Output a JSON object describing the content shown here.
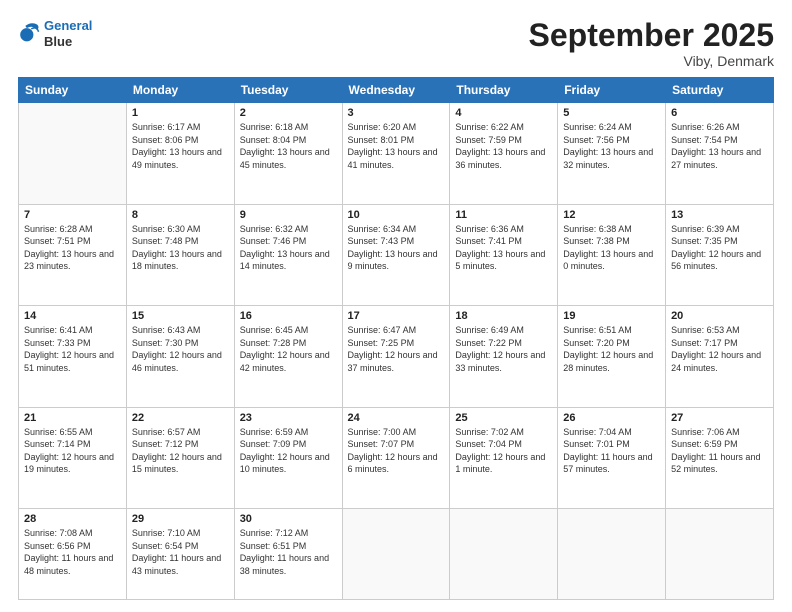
{
  "header": {
    "logo_line1": "General",
    "logo_line2": "Blue",
    "month": "September 2025",
    "location": "Viby, Denmark"
  },
  "weekdays": [
    "Sunday",
    "Monday",
    "Tuesday",
    "Wednesday",
    "Thursday",
    "Friday",
    "Saturday"
  ],
  "weeks": [
    [
      {
        "day": "",
        "sunrise": "",
        "sunset": "",
        "daylight": ""
      },
      {
        "day": "1",
        "sunrise": "Sunrise: 6:17 AM",
        "sunset": "Sunset: 8:06 PM",
        "daylight": "Daylight: 13 hours and 49 minutes."
      },
      {
        "day": "2",
        "sunrise": "Sunrise: 6:18 AM",
        "sunset": "Sunset: 8:04 PM",
        "daylight": "Daylight: 13 hours and 45 minutes."
      },
      {
        "day": "3",
        "sunrise": "Sunrise: 6:20 AM",
        "sunset": "Sunset: 8:01 PM",
        "daylight": "Daylight: 13 hours and 41 minutes."
      },
      {
        "day": "4",
        "sunrise": "Sunrise: 6:22 AM",
        "sunset": "Sunset: 7:59 PM",
        "daylight": "Daylight: 13 hours and 36 minutes."
      },
      {
        "day": "5",
        "sunrise": "Sunrise: 6:24 AM",
        "sunset": "Sunset: 7:56 PM",
        "daylight": "Daylight: 13 hours and 32 minutes."
      },
      {
        "day": "6",
        "sunrise": "Sunrise: 6:26 AM",
        "sunset": "Sunset: 7:54 PM",
        "daylight": "Daylight: 13 hours and 27 minutes."
      }
    ],
    [
      {
        "day": "7",
        "sunrise": "Sunrise: 6:28 AM",
        "sunset": "Sunset: 7:51 PM",
        "daylight": "Daylight: 13 hours and 23 minutes."
      },
      {
        "day": "8",
        "sunrise": "Sunrise: 6:30 AM",
        "sunset": "Sunset: 7:48 PM",
        "daylight": "Daylight: 13 hours and 18 minutes."
      },
      {
        "day": "9",
        "sunrise": "Sunrise: 6:32 AM",
        "sunset": "Sunset: 7:46 PM",
        "daylight": "Daylight: 13 hours and 14 minutes."
      },
      {
        "day": "10",
        "sunrise": "Sunrise: 6:34 AM",
        "sunset": "Sunset: 7:43 PM",
        "daylight": "Daylight: 13 hours and 9 minutes."
      },
      {
        "day": "11",
        "sunrise": "Sunrise: 6:36 AM",
        "sunset": "Sunset: 7:41 PM",
        "daylight": "Daylight: 13 hours and 5 minutes."
      },
      {
        "day": "12",
        "sunrise": "Sunrise: 6:38 AM",
        "sunset": "Sunset: 7:38 PM",
        "daylight": "Daylight: 13 hours and 0 minutes."
      },
      {
        "day": "13",
        "sunrise": "Sunrise: 6:39 AM",
        "sunset": "Sunset: 7:35 PM",
        "daylight": "Daylight: 12 hours and 56 minutes."
      }
    ],
    [
      {
        "day": "14",
        "sunrise": "Sunrise: 6:41 AM",
        "sunset": "Sunset: 7:33 PM",
        "daylight": "Daylight: 12 hours and 51 minutes."
      },
      {
        "day": "15",
        "sunrise": "Sunrise: 6:43 AM",
        "sunset": "Sunset: 7:30 PM",
        "daylight": "Daylight: 12 hours and 46 minutes."
      },
      {
        "day": "16",
        "sunrise": "Sunrise: 6:45 AM",
        "sunset": "Sunset: 7:28 PM",
        "daylight": "Daylight: 12 hours and 42 minutes."
      },
      {
        "day": "17",
        "sunrise": "Sunrise: 6:47 AM",
        "sunset": "Sunset: 7:25 PM",
        "daylight": "Daylight: 12 hours and 37 minutes."
      },
      {
        "day": "18",
        "sunrise": "Sunrise: 6:49 AM",
        "sunset": "Sunset: 7:22 PM",
        "daylight": "Daylight: 12 hours and 33 minutes."
      },
      {
        "day": "19",
        "sunrise": "Sunrise: 6:51 AM",
        "sunset": "Sunset: 7:20 PM",
        "daylight": "Daylight: 12 hours and 28 minutes."
      },
      {
        "day": "20",
        "sunrise": "Sunrise: 6:53 AM",
        "sunset": "Sunset: 7:17 PM",
        "daylight": "Daylight: 12 hours and 24 minutes."
      }
    ],
    [
      {
        "day": "21",
        "sunrise": "Sunrise: 6:55 AM",
        "sunset": "Sunset: 7:14 PM",
        "daylight": "Daylight: 12 hours and 19 minutes."
      },
      {
        "day": "22",
        "sunrise": "Sunrise: 6:57 AM",
        "sunset": "Sunset: 7:12 PM",
        "daylight": "Daylight: 12 hours and 15 minutes."
      },
      {
        "day": "23",
        "sunrise": "Sunrise: 6:59 AM",
        "sunset": "Sunset: 7:09 PM",
        "daylight": "Daylight: 12 hours and 10 minutes."
      },
      {
        "day": "24",
        "sunrise": "Sunrise: 7:00 AM",
        "sunset": "Sunset: 7:07 PM",
        "daylight": "Daylight: 12 hours and 6 minutes."
      },
      {
        "day": "25",
        "sunrise": "Sunrise: 7:02 AM",
        "sunset": "Sunset: 7:04 PM",
        "daylight": "Daylight: 12 hours and 1 minute."
      },
      {
        "day": "26",
        "sunrise": "Sunrise: 7:04 AM",
        "sunset": "Sunset: 7:01 PM",
        "daylight": "Daylight: 11 hours and 57 minutes."
      },
      {
        "day": "27",
        "sunrise": "Sunrise: 7:06 AM",
        "sunset": "Sunset: 6:59 PM",
        "daylight": "Daylight: 11 hours and 52 minutes."
      }
    ],
    [
      {
        "day": "28",
        "sunrise": "Sunrise: 7:08 AM",
        "sunset": "Sunset: 6:56 PM",
        "daylight": "Daylight: 11 hours and 48 minutes."
      },
      {
        "day": "29",
        "sunrise": "Sunrise: 7:10 AM",
        "sunset": "Sunset: 6:54 PM",
        "daylight": "Daylight: 11 hours and 43 minutes."
      },
      {
        "day": "30",
        "sunrise": "Sunrise: 7:12 AM",
        "sunset": "Sunset: 6:51 PM",
        "daylight": "Daylight: 11 hours and 38 minutes."
      },
      {
        "day": "",
        "sunrise": "",
        "sunset": "",
        "daylight": ""
      },
      {
        "day": "",
        "sunrise": "",
        "sunset": "",
        "daylight": ""
      },
      {
        "day": "",
        "sunrise": "",
        "sunset": "",
        "daylight": ""
      },
      {
        "day": "",
        "sunrise": "",
        "sunset": "",
        "daylight": ""
      }
    ]
  ]
}
